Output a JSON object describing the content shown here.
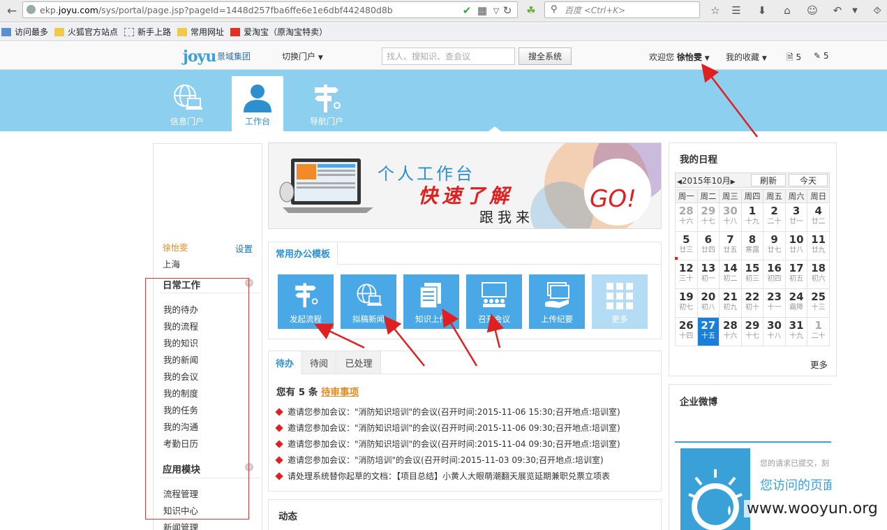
{
  "browser": {
    "url_prefix": "ekp.",
    "url_host": "joyu.com",
    "url_path": "/sys/portal/page.jsp?pageId=1448d257fba6ffe6e1e6dbf442480d8b",
    "search_placeholder": "百度 <Ctrl+K>"
  },
  "bookmarks": [
    {
      "label": "访问最多",
      "icon": "bookmarks-icon"
    },
    {
      "label": "火狐官方站点",
      "icon": "folder-icon"
    },
    {
      "label": "新手上路",
      "icon": "page-icon"
    },
    {
      "label": "常用网址",
      "icon": "folder-icon"
    },
    {
      "label": "爱淘宝（原淘宝特卖）",
      "icon": "taobao-icon"
    }
  ],
  "header": {
    "logo_text": "joyu",
    "logo_sub": "景域集团",
    "switch_portal": "切换门户",
    "search_placeholder": "找人、搜知识、查会议",
    "search_button": "搜全系统",
    "welcome_prefix": "欢迎您",
    "username": "徐怡雯",
    "favorites": "我的收藏",
    "doc_count": "5",
    "task_count": "5"
  },
  "portals": [
    {
      "label": "信息门户",
      "icon": "globe-laptop-icon",
      "active": false
    },
    {
      "label": "工作台",
      "icon": "person-icon",
      "active": true
    },
    {
      "label": "导航门户",
      "icon": "signpost-icon",
      "active": false
    }
  ],
  "sidebar": {
    "user": "徐怡雯",
    "settings": "设置",
    "city": "上海",
    "daily_title": "日常工作",
    "daily_items": [
      "我的待办",
      "我的流程",
      "我的知识",
      "我的新闻",
      "我的会议",
      "我的制度",
      "我的任务",
      "我的沟通",
      "考勤日历"
    ],
    "apps_title": "应用模块",
    "apps_items": [
      "流程管理",
      "知识中心",
      "新闻管理"
    ]
  },
  "banner": {
    "line1": "个人工作台",
    "line2": "快速了解",
    "line3": "跟我来",
    "go": "GO!"
  },
  "templates": {
    "tab": "常用办公模板",
    "items": [
      {
        "label": "发起流程",
        "icon": "signpost-icon"
      },
      {
        "label": "拟稿新闻",
        "icon": "globe-laptop-icon"
      },
      {
        "label": "知识上传",
        "icon": "document-icon"
      },
      {
        "label": "召开会议",
        "icon": "meeting-icon"
      },
      {
        "label": "上传纪要",
        "icon": "upload-hand-icon"
      },
      {
        "label": "更多",
        "icon": "grid-icon"
      }
    ]
  },
  "tasks": {
    "tabs": [
      "待办",
      "待阅",
      "已处理"
    ],
    "summary_prefix": "您有",
    "summary_count": "5",
    "summary_unit": "条",
    "summary_link": "待审事项",
    "items": [
      "邀请您参加会议：\"消防知识培训\"的会议(召开时间:2015-11-06 15:30;召开地点:培训室)",
      "邀请您参加会议：\"消防知识培训\"的会议(召开时间:2015-11-06 09:30;召开地点:培训室)",
      "邀请您参加会议：\"消防知识培训\"的会议(召开时间:2015-11-04 09:30;召开地点:培训室)",
      "邀请您参加会议：\"消防培训\"的会议(召开时间:2015-11-03 09:30;召开地点:培训室)",
      "请处理系统替你起草的文档：【项目总结】小黄人大眼萌潮翻天展览延期兼职兑票立项表"
    ]
  },
  "dynamics": {
    "title": "动态"
  },
  "calendar": {
    "title": "我的日程",
    "month": "2015年10月",
    "refresh": "刷新",
    "today": "今天",
    "weekdays": [
      "周一",
      "周二",
      "周三",
      "周四",
      "周五",
      "周六",
      "周日"
    ],
    "weeks": [
      [
        {
          "d": "28",
          "l": "十六",
          "o": true
        },
        {
          "d": "29",
          "l": "十七",
          "o": true
        },
        {
          "d": "30",
          "l": "十八",
          "o": true
        },
        {
          "d": "1",
          "l": "十九"
        },
        {
          "d": "2",
          "l": "二十"
        },
        {
          "d": "3",
          "l": "廿一"
        },
        {
          "d": "4",
          "l": "廿二"
        }
      ],
      [
        {
          "d": "5",
          "l": "廿三"
        },
        {
          "d": "6",
          "l": "廿四"
        },
        {
          "d": "7",
          "l": "廿五"
        },
        {
          "d": "8",
          "l": "寒露"
        },
        {
          "d": "9",
          "l": "廿七"
        },
        {
          "d": "10",
          "l": "廿八"
        },
        {
          "d": "11",
          "l": "廿九"
        }
      ],
      [
        {
          "d": "12",
          "l": "三十"
        },
        {
          "d": "13",
          "l": "初一"
        },
        {
          "d": "14",
          "l": "初二"
        },
        {
          "d": "15",
          "l": "初三"
        },
        {
          "d": "16",
          "l": "初四"
        },
        {
          "d": "17",
          "l": "初五"
        },
        {
          "d": "18",
          "l": "初六"
        }
      ],
      [
        {
          "d": "19",
          "l": "初七"
        },
        {
          "d": "20",
          "l": "初八"
        },
        {
          "d": "21",
          "l": "初九"
        },
        {
          "d": "22",
          "l": "初十"
        },
        {
          "d": "23",
          "l": "十一"
        },
        {
          "d": "24",
          "l": "霜降"
        },
        {
          "d": "25",
          "l": "十三"
        }
      ],
      [
        {
          "d": "26",
          "l": "十四"
        },
        {
          "d": "27",
          "l": "十五",
          "t": true
        },
        {
          "d": "28",
          "l": "十六"
        },
        {
          "d": "29",
          "l": "十七"
        },
        {
          "d": "30",
          "l": "十八"
        },
        {
          "d": "31",
          "l": "十九"
        },
        {
          "d": "1",
          "l": "二十",
          "o": true
        }
      ]
    ],
    "more": "更多"
  },
  "weibo": {
    "title": "企业微博",
    "error_small": "您的请求已提交，刻",
    "error_big": "您访问的页面"
  },
  "watermark": "www.wooyun.org",
  "colors": {
    "brand_blue": "#8ccfee",
    "tile_blue": "#4aa8e6",
    "accent_orange": "#e28a1f",
    "annotation_red": "#d23b3b"
  }
}
